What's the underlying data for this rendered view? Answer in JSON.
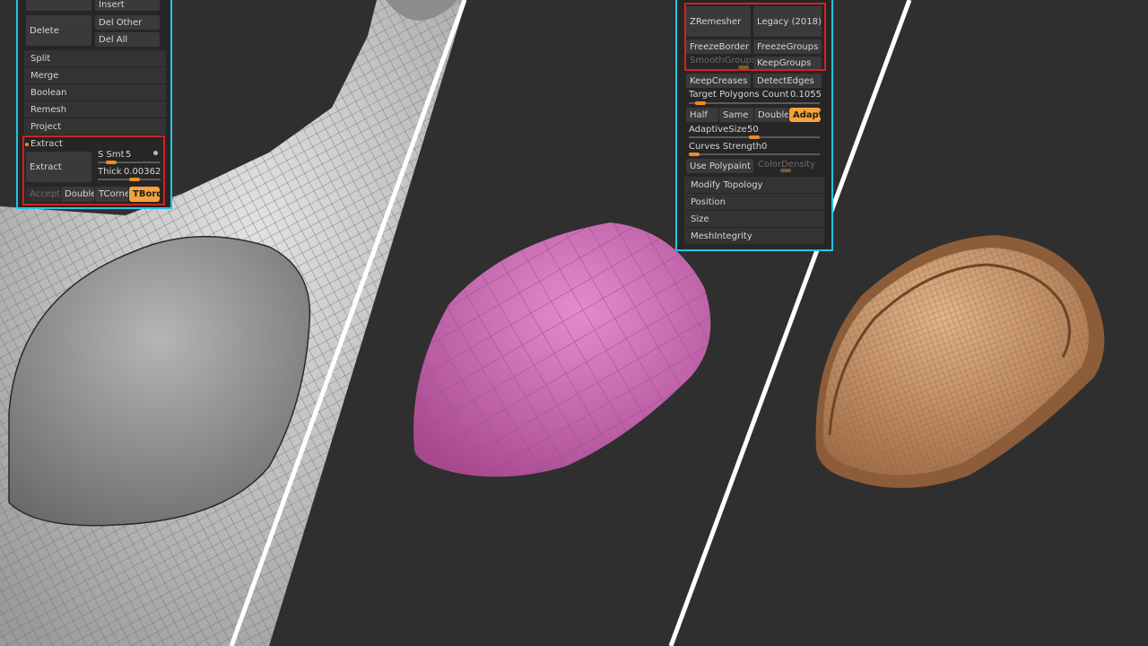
{
  "colors": {
    "background": "#2f2f2f",
    "panel": "#262626",
    "panel_frame": "#22c5e6",
    "highlight_frame": "#d71f1f",
    "active_button": "#f5a23a",
    "slider_knob": "#f08c1e",
    "extracted_mesh": "#d872c2",
    "final_mesh": "#c9956a"
  },
  "left_panel": {
    "insert": "Insert",
    "delete": "Delete",
    "del_other": "Del Other",
    "del_all": "Del All",
    "sections": [
      "Split",
      "Merge",
      "Boolean",
      "Remesh",
      "Project"
    ],
    "extract_header": "Extract",
    "extract_button": "Extract",
    "s_smt_label": "S Smt",
    "s_smt_value": "5",
    "s_smt_level": 0.15,
    "thick_label": "Thick",
    "thick_value": "0.00362",
    "thick_level": 0.6,
    "accept": "Accept",
    "double": "Double",
    "tcorner": "TCorne",
    "tborder": "TBorde"
  },
  "right_panel": {
    "zremesher": "ZRemesher",
    "legacy": "Legacy (2018)",
    "freeze_border": "FreezeBorder",
    "freeze_groups": "FreezeGroups",
    "smooth_groups": "SmoothGroups",
    "keep_groups": "KeepGroups",
    "keep_creases": "KeepCreases",
    "detect_edges": "DetectEdges",
    "target_polygons_label": "Target Polygons Count",
    "target_polygons_value": "0.1055",
    "target_polygons_level": 0.05,
    "half": "Half",
    "same": "Same",
    "double": "Double",
    "adapt": "Adapt",
    "adaptive_size_label": "AdaptiveSize",
    "adaptive_size_value": "50",
    "adaptive_size_level": 0.5,
    "curves_strength_label": "Curves Strength",
    "curves_strength_value": "0",
    "curves_strength_level": 0.0,
    "use_polypaint": "Use Polypaint",
    "color_density": "ColorDensity",
    "sections": [
      "Modify Topology",
      "Position",
      "Size",
      "MeshIntegrity"
    ]
  }
}
